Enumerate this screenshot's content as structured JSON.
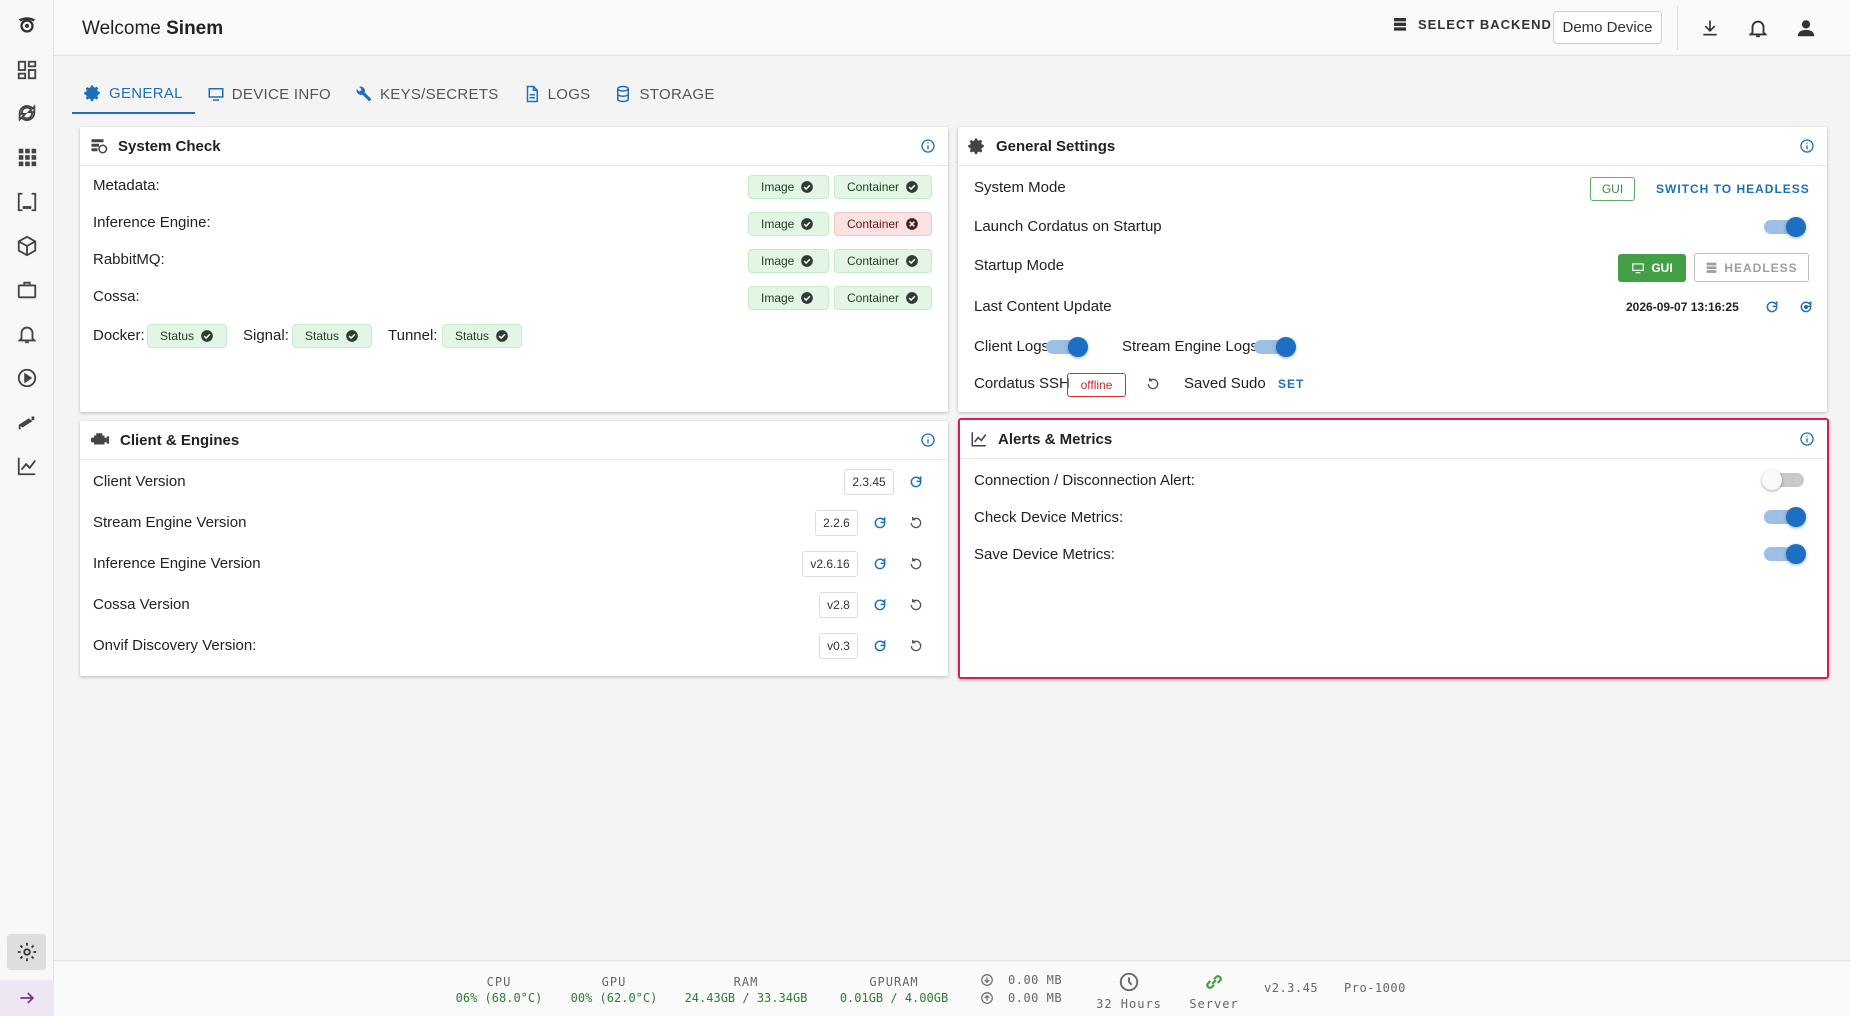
{
  "header": {
    "welcome_prefix": "Welcome",
    "user_name": "Sinem",
    "select_backend": "SELECT BACKEND",
    "device_button": "Demo Device"
  },
  "tabs": [
    {
      "label": "GENERAL",
      "icon": "gear-icon",
      "active": true
    },
    {
      "label": "DEVICE INFO",
      "icon": "monitor-icon"
    },
    {
      "label": "KEYS/SECRETS",
      "icon": "wrench-icon"
    },
    {
      "label": "LOGS",
      "icon": "document-icon"
    },
    {
      "label": "STORAGE",
      "icon": "database-icon"
    }
  ],
  "system_check": {
    "title": "System Check",
    "rows": [
      {
        "label": "Metadata:",
        "image": "Image",
        "container": "Container",
        "container_ok": true
      },
      {
        "label": "Inference Engine:",
        "image": "Image",
        "container": "Container",
        "container_ok": false
      },
      {
        "label": "RabbitMQ:",
        "image": "Image",
        "container": "Container",
        "container_ok": true
      },
      {
        "label": "Cossa:",
        "image": "Image",
        "container": "Container",
        "container_ok": true
      }
    ],
    "services": [
      {
        "label": "Docker:",
        "status": "Status"
      },
      {
        "label": "Signal:",
        "status": "Status"
      },
      {
        "label": "Tunnel:",
        "status": "Status"
      }
    ]
  },
  "general_settings": {
    "title": "General Settings",
    "system_mode_label": "System Mode",
    "system_mode_value": "GUI",
    "switch_link": "SWITCH TO HEADLESS",
    "launch_label": "Launch Cordatus on Startup",
    "launch_on": true,
    "startup_mode_label": "Startup Mode",
    "gui_button": "GUI",
    "headless_button": "HEADLESS",
    "last_update_label": "Last Content Update",
    "last_update_value": "2026-09-07 13:16:25",
    "client_logs_label": "Client Logs",
    "stream_logs_label": "Stream Engine Logs",
    "ssh_label": "Cordatus SSH",
    "ssh_status": "offline",
    "sudo_label": "Saved Sudo",
    "set_link": "SET"
  },
  "client_engines": {
    "title": "Client & Engines",
    "rows": [
      {
        "label": "Client Version",
        "version": "2.3.45"
      },
      {
        "label": "Stream Engine Version",
        "version": "2.2.6"
      },
      {
        "label": "Inference Engine Version",
        "version": "v2.6.16"
      },
      {
        "label": "Cossa Version",
        "version": "v2.8"
      },
      {
        "label": "Onvif Discovery Version:",
        "version": "v0.3"
      }
    ]
  },
  "alerts_metrics": {
    "title": "Alerts & Metrics",
    "rows": [
      {
        "label": "Connection / Disconnection Alert:",
        "on": false
      },
      {
        "label": "Check Device Metrics:",
        "on": true
      },
      {
        "label": "Save Device Metrics:",
        "on": true
      }
    ]
  },
  "footer": {
    "cpu_label": "CPU",
    "cpu_value": "06% (68.0°C)",
    "gpu_label": "GPU",
    "gpu_value": "00% (62.0°C)",
    "ram_label": "RAM",
    "ram_value": "24.43GB / 33.34GB",
    "gpuram_label": "GPURAM",
    "gpuram_value": "0.01GB / 4.00GB",
    "download": "0.00 MB",
    "upload": "0.00 MB",
    "uptime": "32 Hours",
    "server": "Server",
    "version": "v2.3.45",
    "model": "Pro-1000"
  },
  "colors": {
    "accent": "#1d6fb8",
    "ok": "#2e7d32",
    "error": "#c62828",
    "highlight_border": "#d81b60"
  }
}
